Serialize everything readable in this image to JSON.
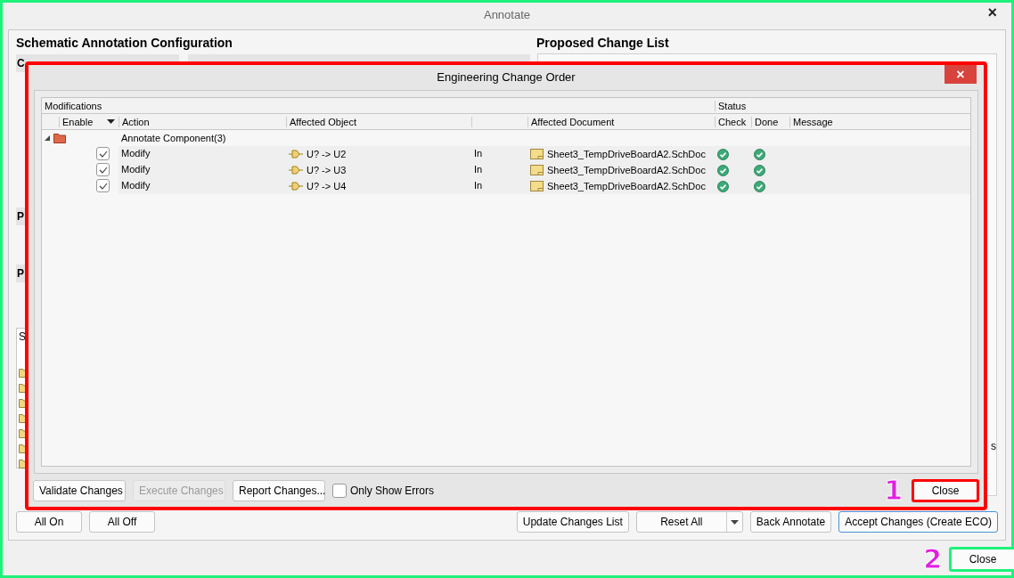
{
  "window": {
    "title": "Annotate",
    "close": "×"
  },
  "left_panel": {
    "title": "Schematic Annotation Configuration",
    "section_1": "C",
    "section_2": "P",
    "section_3": "P",
    "list_header": "S",
    "list_rows": [
      {
        "kind": "folder"
      },
      {
        "kind": "folder"
      },
      {
        "kind": "folder"
      },
      {
        "kind": "folder"
      },
      {
        "kind": "folder"
      },
      {
        "kind": "folder"
      },
      {
        "kind": "folder"
      }
    ]
  },
  "right_panel": {
    "title": "Proposed Change List",
    "fragment": "s"
  },
  "left_buttons": [
    {
      "label": "All On"
    },
    {
      "label": "All Off"
    }
  ],
  "right_buttons": [
    {
      "label": "Update Changes List",
      "split": false,
      "default": false
    },
    {
      "label": "Reset All",
      "split": true,
      "default": false
    },
    {
      "label": "Back Annotate",
      "split": false,
      "default": false
    },
    {
      "label": "Accept Changes (Create ECO)",
      "split": false,
      "default": true
    }
  ],
  "close_button": {
    "label": "Close",
    "callout": "2"
  },
  "eco_dialog": {
    "title": "Engineering Change Order",
    "close": "×",
    "group_headers": [
      "Modifications",
      "Status"
    ],
    "columns": [
      "Enable",
      "Action",
      "Affected Object",
      "Affected Document",
      "Check",
      "Done",
      "Message"
    ],
    "groups": [
      {
        "label": "Annotate Component(3)",
        "expanded": true,
        "children": [
          {
            "enabled": true,
            "action": "Modify",
            "object": "U? -> U2",
            "direction": "In",
            "document": "Sheet3_TempDriveBoardA2.SchDoc",
            "check_passed": true,
            "done_passed": true
          },
          {
            "enabled": true,
            "action": "Modify",
            "object": "U? -> U3",
            "direction": "In",
            "document": "Sheet3_TempDriveBoardA2.SchDoc",
            "check_passed": true,
            "done_passed": true
          },
          {
            "enabled": true,
            "action": "Modify",
            "object": "U? -> U4",
            "direction": "In",
            "document": "Sheet3_TempDriveBoardA2.SchDoc",
            "check_passed": true,
            "done_passed": true
          }
        ]
      }
    ],
    "footer_buttons": [
      {
        "label": "Validate Changes",
        "disabled": false
      },
      {
        "label": "Execute Changes",
        "disabled": true
      },
      {
        "label": "Report Changes...",
        "disabled": false
      }
    ],
    "only_show_errors": {
      "label": "Only Show Errors",
      "checked": false
    },
    "close_button": {
      "label": "Close",
      "callout": "1"
    }
  }
}
